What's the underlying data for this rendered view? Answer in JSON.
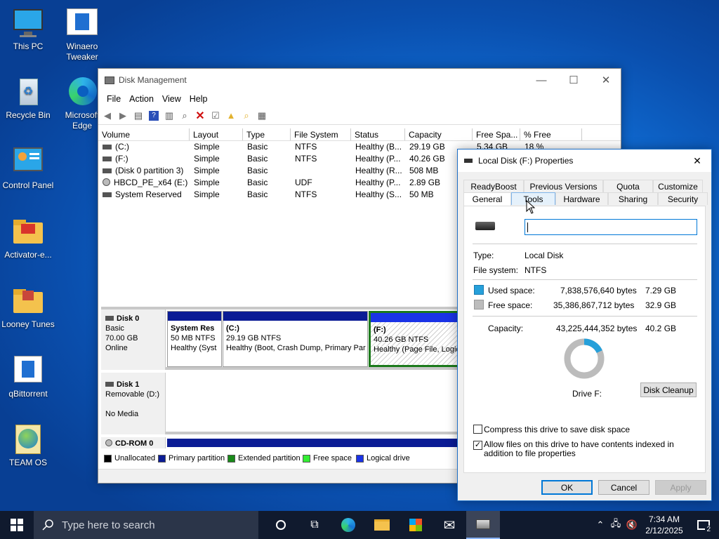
{
  "desktop": {
    "icons": [
      {
        "label": "This PC"
      },
      {
        "label": "Winaero Tweaker"
      },
      {
        "label": "Recycle Bin"
      },
      {
        "label": "Microsoft Edge"
      },
      {
        "label": "Control Panel"
      },
      {
        "label": "Activator-e..."
      },
      {
        "label": "Looney Tunes"
      },
      {
        "label": "qBittorrent"
      },
      {
        "label": "TEAM OS"
      }
    ]
  },
  "disk_management": {
    "title": "Disk Management",
    "menu": [
      "File",
      "Action",
      "View",
      "Help"
    ],
    "columns": [
      "Volume",
      "Layout",
      "Type",
      "File System",
      "Status",
      "Capacity",
      "Free Spa...",
      "% Free"
    ],
    "rows": [
      {
        "volume": "(C:)",
        "layout": "Simple",
        "type": "Basic",
        "fs": "NTFS",
        "status": "Healthy (B...",
        "capacity": "29.19 GB",
        "free": "5.34 GB",
        "pct": "18 %"
      },
      {
        "volume": "(F:)",
        "layout": "Simple",
        "type": "Basic",
        "fs": "NTFS",
        "status": "Healthy (P...",
        "capacity": "40.26 GB",
        "free": "",
        "pct": ""
      },
      {
        "volume": "(Disk 0 partition 3)",
        "layout": "Simple",
        "type": "Basic",
        "fs": "",
        "status": "Healthy (R...",
        "capacity": "508 MB",
        "free": "",
        "pct": ""
      },
      {
        "volume": "HBCD_PE_x64 (E:)",
        "layout": "Simple",
        "type": "Basic",
        "fs": "UDF",
        "status": "Healthy (P...",
        "capacity": "2.89 GB",
        "free": "",
        "pct": ""
      },
      {
        "volume": "System Reserved",
        "layout": "Simple",
        "type": "Basic",
        "fs": "NTFS",
        "status": "Healthy (S...",
        "capacity": "50 MB",
        "free": "",
        "pct": ""
      }
    ],
    "disk0": {
      "name": "Disk 0",
      "type": "Basic",
      "size": "70.00 GB",
      "state": "Online",
      "parts": [
        {
          "name": "System Res",
          "size": "50 MB NTFS",
          "status": "Healthy (Syst"
        },
        {
          "name": "(C:)",
          "size": "29.19 GB NTFS",
          "status": "Healthy (Boot, Crash Dump, Primary Par"
        },
        {
          "name": "(F:)",
          "size": "40.26 GB NTFS",
          "status": "Healthy (Page File, Logic"
        }
      ]
    },
    "disk1": {
      "name": "Disk 1",
      "type": "Removable (D:)",
      "state": "No Media"
    },
    "cdrom": {
      "name": "CD-ROM 0"
    },
    "legend": [
      {
        "label": "Unallocated",
        "color": "#000000"
      },
      {
        "label": "Primary partition",
        "color": "#0b1c95"
      },
      {
        "label": "Extended partition",
        "color": "#1a8a1a"
      },
      {
        "label": "Free space",
        "color": "#33ee33"
      },
      {
        "label": "Logical drive",
        "color": "#1a33e6"
      }
    ]
  },
  "properties": {
    "title": "Local Disk (F:) Properties",
    "tabs_top": [
      "ReadyBoost",
      "Previous Versions",
      "Quota",
      "Customize"
    ],
    "tabs_bottom": [
      "General",
      "Tools",
      "Hardware",
      "Sharing",
      "Security"
    ],
    "name_value": "",
    "type_label": "Type:",
    "type_value": "Local Disk",
    "fs_label": "File system:",
    "fs_value": "NTFS",
    "used_label": "Used space:",
    "used_bytes": "7,838,576,640 bytes",
    "used_gb": "7.29 GB",
    "free_label": "Free space:",
    "free_bytes": "35,386,867,712 bytes",
    "free_gb": "32.9 GB",
    "cap_label": "Capacity:",
    "cap_bytes": "43,225,444,352 bytes",
    "cap_gb": "40.2 GB",
    "drive_label": "Drive F:",
    "cleanup": "Disk Cleanup",
    "compress": "Compress this drive to save disk space",
    "index": "Allow files on this drive to have contents indexed in addition to file properties",
    "ok": "OK",
    "cancel": "Cancel",
    "apply": "Apply",
    "used_color": "#26a0da",
    "free_color": "#bcbcbc",
    "used_fraction": 0.181
  },
  "taskbar": {
    "search_placeholder": "Type here to search",
    "time": "7:34 AM",
    "date": "2/12/2025",
    "notif_count": "2"
  }
}
